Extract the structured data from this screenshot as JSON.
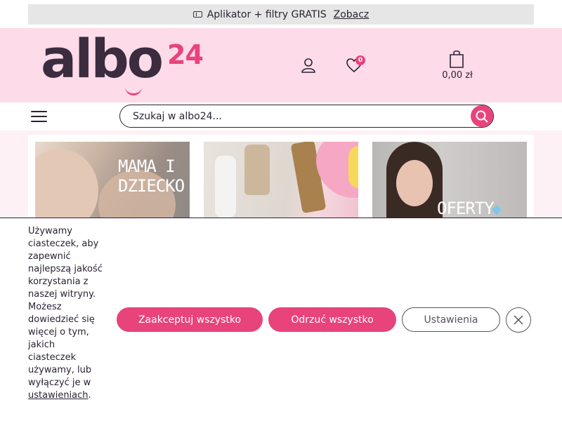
{
  "promo": {
    "icon": "ticket-icon",
    "text": "Aplikator + filtry GRATIS",
    "link": "Zobacz"
  },
  "logo": {
    "word": "albo",
    "number": "24"
  },
  "header": {
    "user_icon": "user-icon",
    "wishlist_icon": "heart-icon",
    "wishlist_count": "0",
    "cart_icon": "shopping-bag-icon",
    "cart_total": "0,00 zł"
  },
  "nav": {
    "menu_icon": "hamburger-icon",
    "search_placeholder": "Szukaj w albo24...",
    "search_icon": "search-icon"
  },
  "tiles": [
    {
      "title": "MAMA I DZIECKO"
    },
    {
      "title": ""
    },
    {
      "title": "OFERTY"
    }
  ],
  "cookie": {
    "text": "Używamy ciasteczek, aby zapewnić najlepszą jakość korzystania z naszej witryny. Możesz dowiedzieć się więcej o tym, jakich ciasteczek używamy, lub wyłączyć je w ",
    "link": "ustawieniach",
    "suffix": ".",
    "accept": "Zaakceptuj wszystko",
    "reject": "Odrzuć wszystko",
    "settings": "Ustawienia",
    "close_icon": "close-icon"
  },
  "colors": {
    "accent": "#e8437a",
    "header_bg": "#fddbe8",
    "text": "#2b2233",
    "promo_bg": "#e6e6e6"
  }
}
